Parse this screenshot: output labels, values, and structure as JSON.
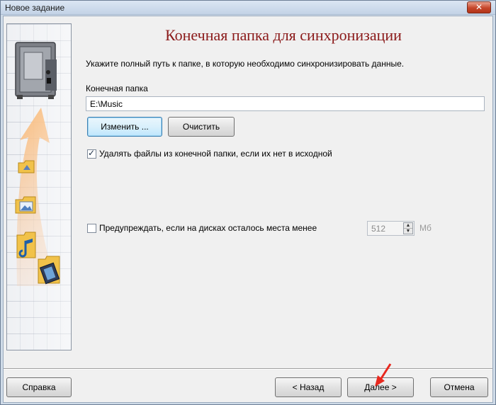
{
  "window": {
    "title": "Новое задание",
    "close_icon": "close-icon"
  },
  "banner": {
    "image": "sync-wizard-banner",
    "icons": [
      "safe-icon",
      "folder-up-icon",
      "folder-image-icon",
      "folder-music-icon",
      "folder-video-icon",
      "orange-arrow-icon"
    ]
  },
  "main": {
    "heading": "Конечная папка для синхронизации",
    "instruction": "Укажите полный путь к папке, в которую необходимо синхронизировать данные.",
    "folder_label": "Конечная папка",
    "folder_value": "E:\\Music",
    "change_button": "Изменить ...",
    "clear_button": "Очистить",
    "delete_checkbox": {
      "label": "Удалять файлы из конечной папки, если их нет в исходной",
      "checked": true
    },
    "warn_checkbox": {
      "label": "Предупреждать, если на дисках осталось места менее",
      "checked": false
    },
    "space_value": "512",
    "space_unit": "Мб"
  },
  "footer": {
    "help_button": "Справка",
    "back_button": "< Назад",
    "next_button": "Далее >",
    "cancel_button": "Отмена"
  },
  "colors": {
    "heading": "#8b1a1a",
    "accent_arrow": "#e8281e",
    "banner_arrow": "#f08a3a"
  }
}
